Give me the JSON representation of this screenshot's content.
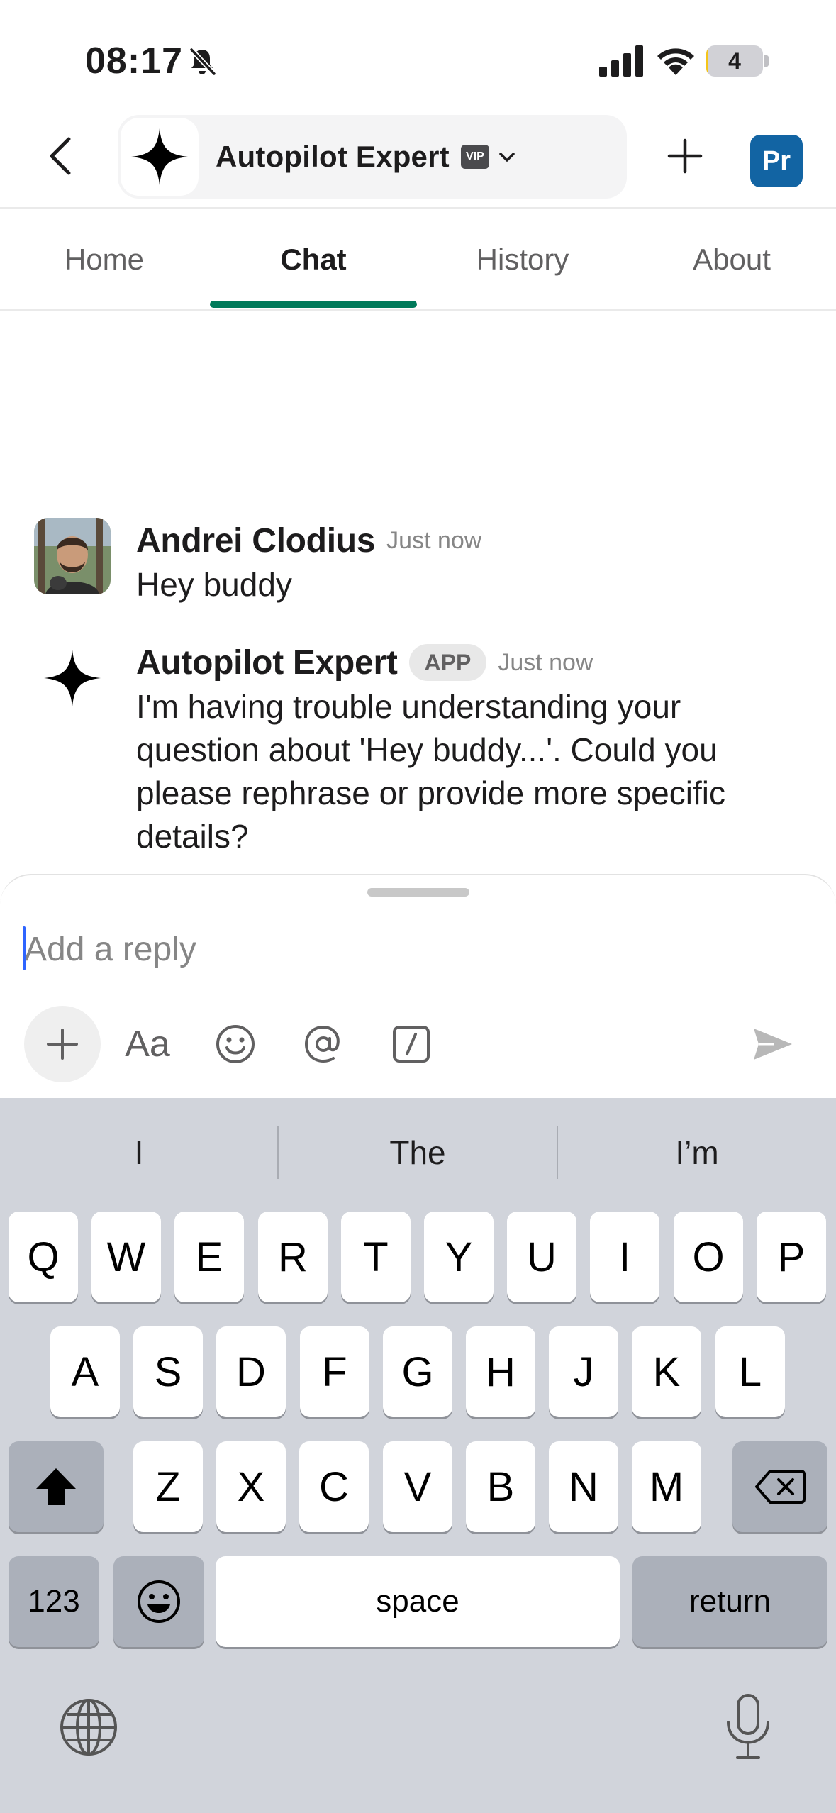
{
  "status_bar": {
    "time": "08:17",
    "battery_level": "4",
    "battery_fraction": 0.04,
    "icons": [
      "bell-slash-icon",
      "signal-icon",
      "wifi-icon",
      "battery-icon"
    ]
  },
  "header": {
    "title": "Autopilot Expert",
    "badge": "VIP",
    "profile_initials": "Pr",
    "accent_color": "#1264a3",
    "icons": [
      "back-chevron-icon",
      "sparkle-star-icon",
      "chevron-down-icon",
      "plus-icon"
    ]
  },
  "tabs": [
    {
      "label": "Home",
      "active": false
    },
    {
      "label": "Chat",
      "active": true
    },
    {
      "label": "History",
      "active": false
    },
    {
      "label": "About",
      "active": false
    }
  ],
  "tab_active_color": "#007a5a",
  "messages": [
    {
      "author": "Andrei Clodius",
      "time": "Just now",
      "text": "Hey buddy"
    },
    {
      "author": "Autopilot Expert",
      "badge": "APP",
      "time": "Just now",
      "text": "I'm having trouble understanding your question about 'Hey buddy...'. Could you please rephrase or provide more specific details?"
    }
  ],
  "composer": {
    "placeholder": "Add a reply",
    "format_label": "Aa",
    "icons": [
      "plus-icon",
      "format-text-icon",
      "emoji-icon",
      "mention-icon",
      "slash-command-icon",
      "send-icon"
    ]
  },
  "keyboard": {
    "suggestions": [
      "I",
      "The",
      "I’m"
    ],
    "row1": [
      "Q",
      "W",
      "E",
      "R",
      "T",
      "Y",
      "U",
      "I",
      "O",
      "P"
    ],
    "row2": [
      "A",
      "S",
      "D",
      "F",
      "G",
      "H",
      "J",
      "K",
      "L"
    ],
    "row3": [
      "Z",
      "X",
      "C",
      "V",
      "B",
      "N",
      "M"
    ],
    "numbers_label": "123",
    "space_label": "space",
    "return_label": "return",
    "icons": [
      "shift-icon",
      "backspace-icon",
      "emoji-key-icon",
      "globe-icon",
      "microphone-icon"
    ]
  }
}
